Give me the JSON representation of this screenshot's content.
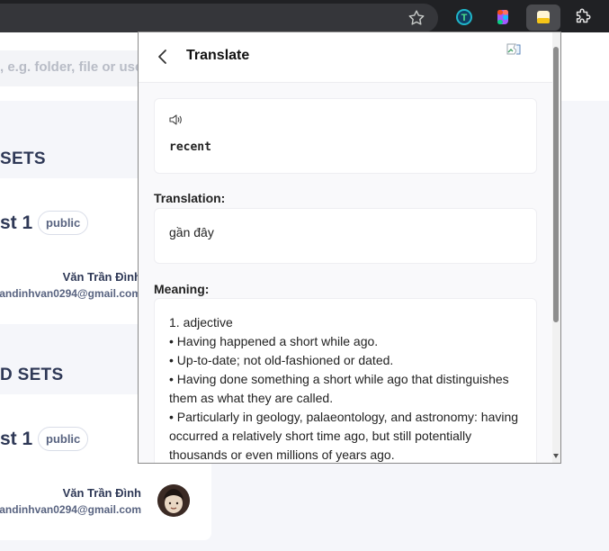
{
  "page": {
    "search_placeholder": ", e.g. folder, file or user",
    "sections": [
      {
        "title": "SETS",
        "set": {
          "name": "st 1",
          "badge": "public",
          "owner_name": "Văn Trần Đình",
          "owner_email": "andinhvan0294@gmail.com"
        }
      },
      {
        "title": "D SETS",
        "set": {
          "name": "st 1",
          "badge": "public",
          "owner_name": "Văn Trần Đình",
          "owner_email": "andinhvan0294@gmail.com"
        }
      }
    ]
  },
  "popup": {
    "title": "Translate",
    "word": "recent",
    "translation_label": "Translation:",
    "translation": "gần đây",
    "meaning_label": "Meaning:",
    "meaning_lines": [
      "1. adjective",
      "• Having happened a short while ago.",
      "• Up-to-date; not old-fashioned or dated.",
      "• Having done something a short while ago that distinguishes them as what they are called.",
      "• Particularly in geology, palaeontology, and astronomy: having occurred a relatively short time ago, but still potentially thousands or even millions of years ago."
    ]
  },
  "icons": {
    "bookmark": "star-icon",
    "extensions": [
      "extension-t-icon",
      "extension-figma-icon",
      "extension-translate-icon",
      "puzzle-icon"
    ],
    "popup_back": "chevron-left-icon",
    "popup_image": "broken-image-icon",
    "speaker": "speaker-icon"
  },
  "colors": {
    "chrome_bg": "#202124",
    "address_bar": "#35363a",
    "page_bg": "#f5f6fa",
    "heading": "#2e3856",
    "muted": "#586380"
  }
}
